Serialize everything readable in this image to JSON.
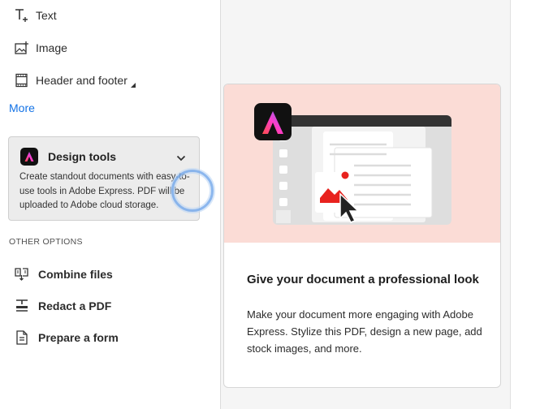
{
  "sidebar": {
    "tools": [
      {
        "label": "Text",
        "icon": "text-add-icon"
      },
      {
        "label": "Image",
        "icon": "image-add-icon"
      },
      {
        "label": "Header and footer",
        "icon": "header-footer-icon"
      }
    ],
    "more_label": "More",
    "design_tools": {
      "title": "Design tools",
      "description": "Create standout documents with easy-to-use tools in Adobe Express. PDF will be uploaded to Adobe cloud storage.",
      "icon": "adobe-express-icon"
    },
    "other_options_label": "OTHER OPTIONS",
    "options": [
      {
        "label": "Combine files",
        "icon": "combine-files-icon"
      },
      {
        "label": "Redact a PDF",
        "icon": "redact-icon"
      },
      {
        "label": "Prepare a form",
        "icon": "prepare-form-icon"
      }
    ]
  },
  "promo": {
    "title": "Give your document a professional look",
    "description": "Make your document more engaging with Adobe Express. Stylize this PDF, design a new page, add stock images, and more."
  },
  "colors": {
    "link": "#1473e6",
    "promo_bg": "#fbdcd6",
    "accent_red": "#e8221e"
  }
}
